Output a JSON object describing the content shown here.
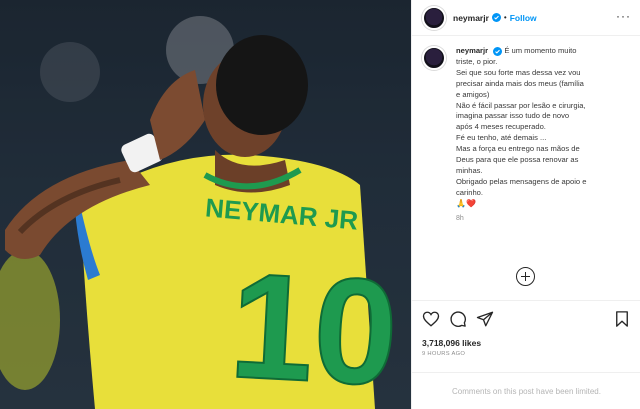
{
  "header": {
    "username": "neymarjr",
    "separator": "•",
    "follow_label": "Follow",
    "more_label": "···"
  },
  "caption": {
    "username": "neymarjr",
    "lines": [
      "É um momento muito",
      "triste, o pior.",
      "Sei que sou forte mas dessa vez vou",
      "precisar ainda mais dos meus (família",
      "e amigos)",
      "Não é fácil passar por lesão e cirurgia,",
      "imagina passar isso tudo de novo",
      "após 4 meses recuperado.",
      "Fé eu tenho, até demais ...",
      "Mas a força eu entrego nas mãos de",
      "Deus para que ele possa renovar as",
      "minhas.",
      "Obrigado pelas mensagens de apoio e",
      "carinho."
    ],
    "emojis": "🙏❤️",
    "time_ago": "8h"
  },
  "stats": {
    "likes": "3,718,096 likes",
    "posted": "9 HOURS AGO"
  },
  "comments_notice": "Comments on this post have been limited.",
  "photo": {
    "jersey_text": "NEYMAR JR",
    "jersey_number": "10"
  },
  "colors": {
    "accent": "#0095f6",
    "jersey_yellow": "#e8df3a",
    "jersey_green": "#1e9a4f",
    "heart": "#ed4956"
  },
  "icons": [
    "verified-icon",
    "more-options-icon",
    "add-comment-icon",
    "like-icon",
    "comment-icon",
    "share-icon",
    "save-icon"
  ]
}
